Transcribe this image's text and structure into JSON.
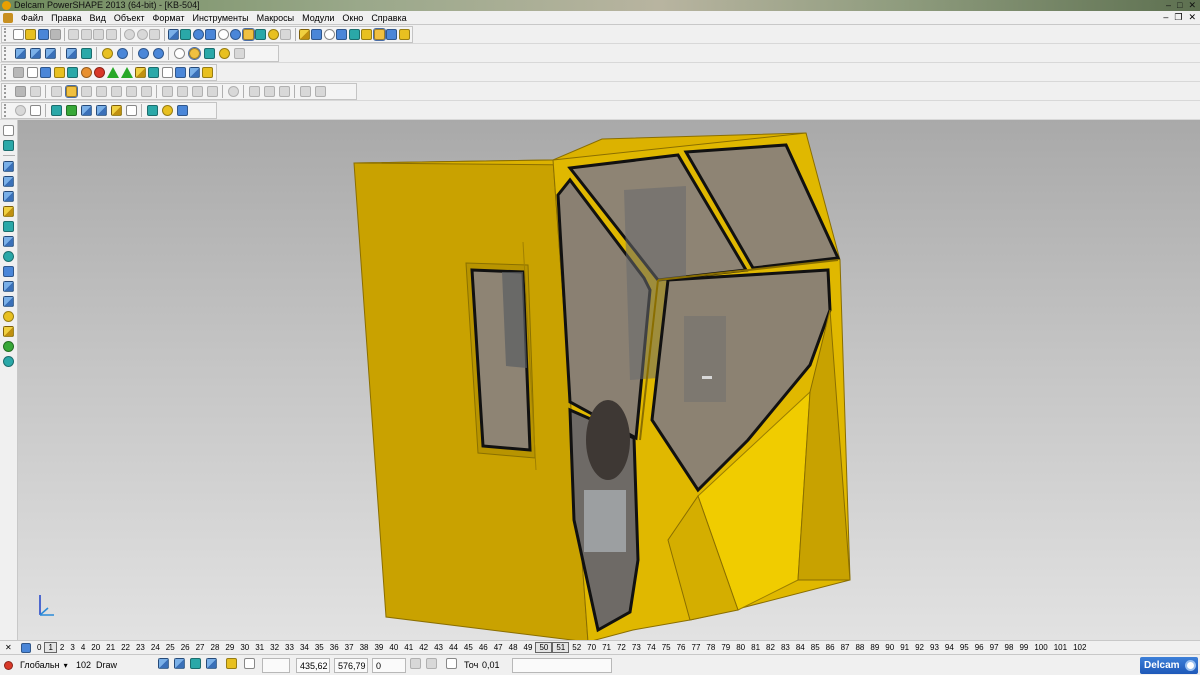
{
  "window": {
    "title": "Delcam PowerSHAPE 2013 (64-bit) - [KB-504]",
    "controls": {
      "minimize": "–",
      "maximize": "□",
      "close": "✕"
    }
  },
  "menu": {
    "items": [
      "Файл",
      "Правка",
      "Вид",
      "Объект",
      "Формат",
      "Инструменты",
      "Макросы",
      "Модули",
      "Окно",
      "Справка"
    ],
    "doc_controls": {
      "minimize": "–",
      "restore": "❐",
      "close": "✕"
    }
  },
  "levels": {
    "visible": [
      "0",
      "1",
      "2",
      "3",
      "4",
      "20",
      "21",
      "22",
      "23",
      "24",
      "25",
      "26",
      "27",
      "28",
      "29",
      "30",
      "31",
      "32",
      "33",
      "34",
      "35",
      "36",
      "37",
      "38",
      "39",
      "40",
      "41",
      "42",
      "43",
      "44",
      "45",
      "46",
      "47",
      "48",
      "49",
      "50",
      "51",
      "52",
      "70",
      "71",
      "72",
      "73",
      "74",
      "75",
      "76",
      "77",
      "78",
      "79",
      "80",
      "81",
      "82",
      "83",
      "84",
      "85",
      "86",
      "87",
      "88",
      "89",
      "90",
      "91",
      "92",
      "93",
      "94",
      "95",
      "96",
      "97",
      "98",
      "99",
      "100",
      "101",
      "102"
    ],
    "active": [
      "1",
      "50",
      "51"
    ]
  },
  "status": {
    "workplane": "Глобальн",
    "level_number": "102",
    "level_name": "Draw plshad",
    "coord_x": "435,62",
    "coord_y": "576,79",
    "coord_z": "0",
    "tolerance_label": "Точ",
    "tolerance_value": "0,01",
    "brand": "Delcam"
  },
  "colors": {
    "cab_body": "#d4aa00",
    "glass": "#8e8474",
    "frame": "#1a1a1a",
    "viewport_top": "#a9a9a9",
    "viewport_bottom": "#e2e2e2"
  },
  "toolbars": {
    "row1_icons": [
      "new-icon",
      "open-icon",
      "save-icon",
      "print-icon",
      "cut-icon",
      "copy-icon",
      "paste-icon",
      "delete-icon",
      "undo-icon",
      "redo-icon",
      "repeat-icon",
      "select-icon",
      "wireframe-icon",
      "zoom-icon",
      "zoom-box-icon",
      "pan-icon",
      "rotate-icon",
      "shaded-icon",
      "light-icon",
      "hand-icon"
    ],
    "row2_icons": [
      "model-tree-icon",
      "layers-icon",
      "material-icon",
      "solid-icon",
      "sphere-icon",
      "cone-icon",
      "play-icon",
      "flag-icon",
      "box-icon",
      "dimension-icon",
      "analysis-icon",
      "assembly-icon"
    ],
    "row3_icons": [
      "surface-icon",
      "extrude-icon",
      "revolve-icon",
      "sweep-icon",
      "loft-icon",
      "fillet-icon",
      "blend-icon",
      "offset-icon",
      "trim-icon",
      "mirror-icon",
      "array-icon",
      "shell-icon"
    ],
    "row4_icons": [
      "primitive-icon",
      "axis-icon",
      "block-icon",
      "cylinder-icon",
      "cone-solid-icon",
      "torus-icon",
      "gear-icon",
      "spring-icon",
      "feature-icon",
      "shape-icon",
      "wedge-icon"
    ],
    "left_icons": [
      "select-arrow-icon",
      "workplane-icon",
      "arc-icon",
      "line-icon",
      "curve-icon",
      "text-icon",
      "surface-tool-icon",
      "solid-tool-icon",
      "dimension-tool-icon",
      "electrode-icon",
      "mesh-icon",
      "lathe-icon",
      "pipe-icon",
      "tool-icon",
      "shape-tool-icon",
      "analysis-tool-icon"
    ]
  }
}
